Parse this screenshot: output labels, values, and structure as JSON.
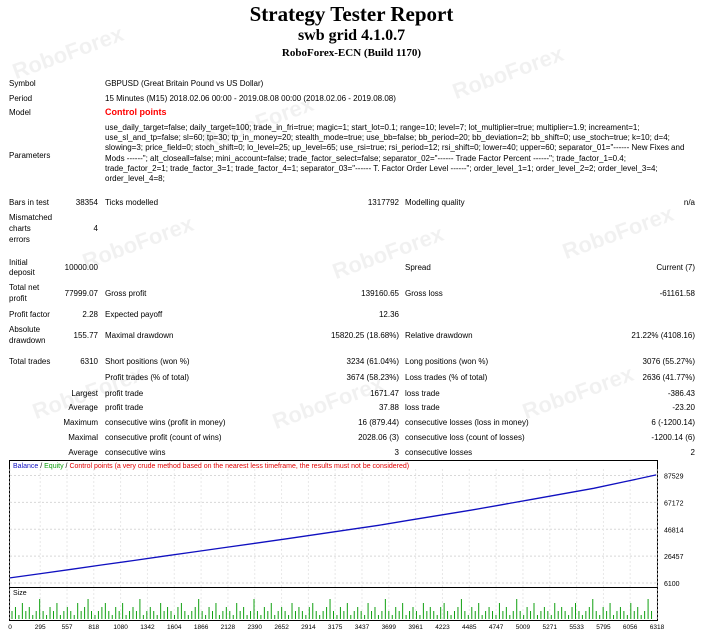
{
  "header": {
    "title": "Strategy Tester Report",
    "expert": "swb grid 4.1.0.7",
    "server": "RoboForex-ECN (Build 1170)"
  },
  "watermark_text": "RoboForex",
  "details": {
    "symbol_label": "Symbol",
    "symbol_value": "GBPUSD (Great Britain Pound vs US Dollar)",
    "period_label": "Period",
    "period_value": "15 Minutes (M15) 2018.02.06 00:00 - 2019.08.08 00:00 (2018.02.06 - 2019.08.08)",
    "model_label": "Model",
    "model_value": "Control points",
    "parameters_label": "Parameters",
    "parameters_value": "use_daily_target=false; daily_target=100; trade_in_fri=true; magic=1; start_lot=0.1; range=10; level=7; lot_multiplier=true; multiplier=1.9; increament=1; use_sl_and_tp=false; sl=60; tp=30; tp_in_money=20; stealth_mode=true; use_bb=false; bb_period=20; bb_deviation=2; bb_shift=0; use_stoch=true; k=10; d=4; slowing=3; price_field=0; stoch_shift=0; lo_level=25; up_level=65; use_rsi=true; rsi_period=12; rsi_shift=0; lower=40; upper=60; separator_01=\"------ New Fixes and Mods ------\"; alt_closeall=false; mini_account=false; trade_factor_select=false; separator_02=\"------ Trade Factor Percent ------\"; trade_factor_1=0.4; trade_factor_2=1; trade_factor_3=1; trade_factor_4=1; separator_03=\"------ T. Factor Order Level ------\"; order_level_1=1; order_level_2=2; order_level_3=4; order_level_4=8;",
    "bars_label": "Bars in test",
    "bars_value": "38354",
    "ticks_label": "Ticks modelled",
    "ticks_value": "1317792",
    "quality_label": "Modelling quality",
    "quality_value": "n/a",
    "mismatch_label_1": "Mismatched",
    "mismatch_label_2": "charts",
    "mismatch_label_3": "errors",
    "mismatch_value": "4",
    "deposit_label_1": "Initial",
    "deposit_label_2": "deposit",
    "deposit_value": "10000.00",
    "spread_label": "Spread",
    "spread_value": "Current (7)",
    "netprofit_label_1": "Total net",
    "netprofit_label_2": "profit",
    "netprofit_value": "77999.07",
    "grossprofit_label": "Gross profit",
    "grossprofit_value": "139160.65",
    "grossloss_label": "Gross loss",
    "grossloss_value": "-61161.58",
    "pf_label": "Profit factor",
    "pf_value": "2.28",
    "ep_label": "Expected payoff",
    "ep_value": "12.36",
    "absdd_label_1": "Absolute",
    "absdd_label_2": "drawdown",
    "absdd_value": "155.77",
    "maxdd_label": "Maximal drawdown",
    "maxdd_value": "15820.25 (18.68%)",
    "reldd_label": "Relative drawdown",
    "reldd_value": "21.22% (4108.16)",
    "tt_label": "Total trades",
    "tt_value": "6310",
    "short_label": "Short positions (won %)",
    "short_value": "3234 (61.04%)",
    "long_label": "Long positions (won %)",
    "long_value": "3076 (55.27%)",
    "pt_label": "Profit trades (% of total)",
    "pt_value": "3674 (58.23%)",
    "lt_label": "Loss trades (% of total)",
    "lt_value": "2636 (41.77%)",
    "largest_label": "Largest",
    "largest_pt_label": "profit trade",
    "largest_pt_value": "1671.47",
    "largest_lt_label": "loss trade",
    "largest_lt_value": "-386.43",
    "average_label": "Average",
    "average_pt_label": "profit trade",
    "average_pt_value": "37.88",
    "average_lt_label": "loss trade",
    "average_lt_value": "-23.20",
    "maximum_label": "Maximum",
    "max_cw_label": "consecutive wins (profit in money)",
    "max_cw_value": "16 (879.44)",
    "max_cl_label": "consecutive losses (loss in money)",
    "max_cl_value": "6 (-1200.14)",
    "maximal_label": "Maximal",
    "maxl_cp_label": "consecutive profit (count of wins)",
    "maxl_cp_value": "2028.06 (3)",
    "maxl_cl_label": "consecutive loss (count of losses)",
    "maxl_cl_value": "-1200.14 (6)",
    "average2_label": "Average",
    "avg_cw_label": "consecutive wins",
    "avg_cw_value": "3",
    "avg_cl_label": "consecutive losses",
    "avg_cl_value": "2"
  },
  "chart_caption": {
    "balance": "Balance",
    "sep1": " / ",
    "equity": "Equity",
    "sep2": " / ",
    "control": "Control points (a very crude method based on the nearest less timeframe, the results must not be considered)",
    "size_label": "Size"
  },
  "colors": {
    "balance": "#1010c0",
    "equity": "#10a010",
    "control": "#e00000",
    "volume": "#10a010"
  },
  "chart_data": {
    "type": "line",
    "title": "",
    "y_ticks": [
      87529,
      67172,
      46814,
      26457,
      6100
    ],
    "ylim": [
      6100,
      92500
    ],
    "x_ticks": [
      "0",
      "295",
      "557",
      "818",
      "1080",
      "1342",
      "1604",
      "1866",
      "2128",
      "2390",
      "2652",
      "2914",
      "3175",
      "3437",
      "3699",
      "3961",
      "4223",
      "4485",
      "4747",
      "5009",
      "5271",
      "5533",
      "5795",
      "6056",
      "6318"
    ],
    "xlim": [
      0,
      6318
    ],
    "series": [
      {
        "name": "Balance",
        "x": [
          0,
          300,
          600,
          900,
          1200,
          1500,
          1800,
          2100,
          2400,
          2700,
          3000,
          3300,
          3600,
          3900,
          4200,
          4500,
          4800,
          5100,
          5400,
          5700,
          6000,
          6310
        ],
        "values": [
          10000,
          13200,
          16500,
          19800,
          23100,
          26400,
          29700,
          33000,
          36300,
          39600,
          43000,
          46400,
          49800,
          53700,
          57500,
          61300,
          65400,
          69500,
          73700,
          77900,
          82800,
          87999
        ]
      }
    ],
    "volume_series": [
      2,
      3,
      1,
      4,
      2,
      3,
      1,
      2,
      5,
      2,
      1,
      3,
      2,
      4,
      1,
      2,
      3,
      2,
      1,
      4,
      2,
      3,
      5,
      2,
      1,
      2,
      3,
      4,
      2,
      1,
      3,
      2,
      4,
      1,
      2,
      3,
      2,
      5,
      1,
      2,
      3,
      2,
      1,
      4,
      2,
      3,
      2,
      1,
      3,
      4,
      2,
      1,
      2,
      3,
      5,
      2,
      1,
      3,
      2,
      4,
      1,
      2,
      3,
      2,
      1,
      4,
      2,
      3,
      1,
      2,
      5,
      2,
      1,
      3,
      2,
      4,
      1,
      2,
      3,
      2,
      1,
      4,
      2,
      3,
      2,
      1,
      3,
      4,
      2,
      1,
      2,
      3,
      5,
      2,
      1,
      3,
      2,
      4,
      1,
      2,
      3,
      2,
      1,
      4,
      2,
      3,
      1,
      2,
      5,
      2,
      1,
      3,
      2,
      4,
      1,
      2,
      3,
      2,
      1,
      4,
      2,
      3,
      2,
      1,
      3,
      4,
      2,
      1,
      2,
      3,
      5,
      2,
      1,
      3,
      2,
      4,
      1,
      2,
      3,
      2,
      1,
      4,
      2,
      3,
      1,
      2,
      5,
      2,
      1,
      3,
      2,
      4,
      1,
      2,
      3,
      2,
      1,
      4,
      2,
      3,
      2,
      1,
      3,
      4,
      2,
      1,
      2,
      3,
      5,
      2,
      1,
      3,
      2,
      4,
      1,
      2,
      3,
      2,
      1,
      4,
      2,
      3,
      1,
      2,
      5,
      2
    ]
  }
}
